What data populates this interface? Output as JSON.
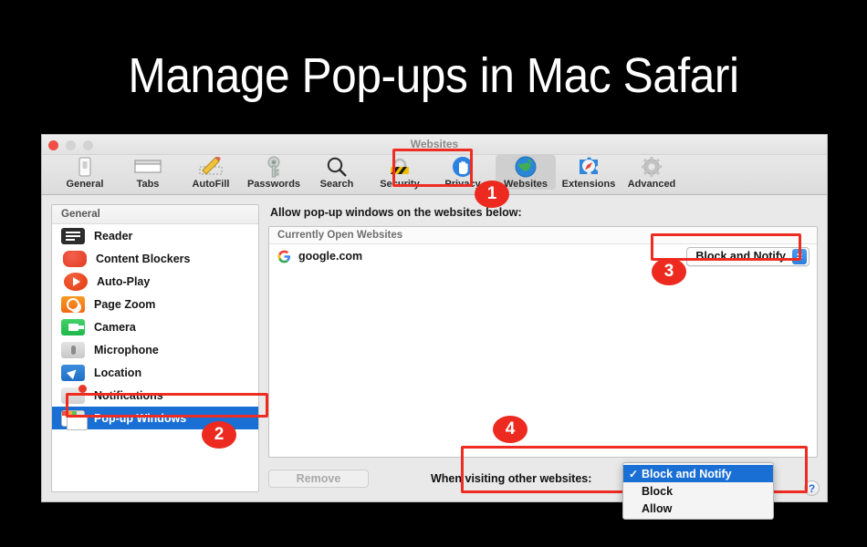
{
  "title": "Manage Pop-ups in Mac Safari",
  "window": {
    "title": "Websites",
    "traffic_lights": [
      "close",
      "minimize",
      "zoom"
    ]
  },
  "toolbar": {
    "items": [
      {
        "label": "General",
        "icon": "general-icon"
      },
      {
        "label": "Tabs",
        "icon": "tabs-icon"
      },
      {
        "label": "AutoFill",
        "icon": "autofill-icon"
      },
      {
        "label": "Passwords",
        "icon": "passwords-icon"
      },
      {
        "label": "Search",
        "icon": "search-icon"
      },
      {
        "label": "Security",
        "icon": "security-icon"
      },
      {
        "label": "Privacy",
        "icon": "privacy-icon"
      },
      {
        "label": "Websites",
        "icon": "websites-icon"
      },
      {
        "label": "Extensions",
        "icon": "extensions-icon"
      },
      {
        "label": "Advanced",
        "icon": "advanced-icon"
      }
    ],
    "selected": "Websites"
  },
  "sidebar": {
    "header": "General",
    "items": [
      {
        "label": "Reader",
        "icon": "reader-icon"
      },
      {
        "label": "Content Blockers",
        "icon": "content-blockers-icon"
      },
      {
        "label": "Auto-Play",
        "icon": "auto-play-icon"
      },
      {
        "label": "Page Zoom",
        "icon": "page-zoom-icon"
      },
      {
        "label": "Camera",
        "icon": "camera-icon"
      },
      {
        "label": "Microphone",
        "icon": "microphone-icon"
      },
      {
        "label": "Location",
        "icon": "location-icon"
      },
      {
        "label": "Notifications",
        "icon": "notifications-icon"
      },
      {
        "label": "Pop-up Windows",
        "icon": "popup-windows-icon"
      }
    ],
    "selected": "Pop-up Windows"
  },
  "main": {
    "heading": "Allow pop-up windows on the websites below:",
    "list_header": "Currently Open Websites",
    "rows": [
      {
        "site": "google.com",
        "icon": "google-icon",
        "setting": "Block and Notify"
      }
    ],
    "remove_label": "Remove",
    "visiting_label": "When visiting other websites:",
    "help_label": "?"
  },
  "menu": {
    "options": [
      "Block and Notify",
      "Block",
      "Allow"
    ],
    "selected": "Block and Notify",
    "check_glyph": "✓"
  },
  "annotations": [
    {
      "badge": "1",
      "target": "websites-toolbar-tab"
    },
    {
      "badge": "2",
      "target": "popup-windows-sidebar-item"
    },
    {
      "badge": "3",
      "target": "site-setting-popup"
    },
    {
      "badge": "4",
      "target": "other-websites-menu"
    }
  ],
  "colors": {
    "accent_blue": "#1a6fd4",
    "annotation_red": "#ec2a20",
    "background": "#000000"
  }
}
